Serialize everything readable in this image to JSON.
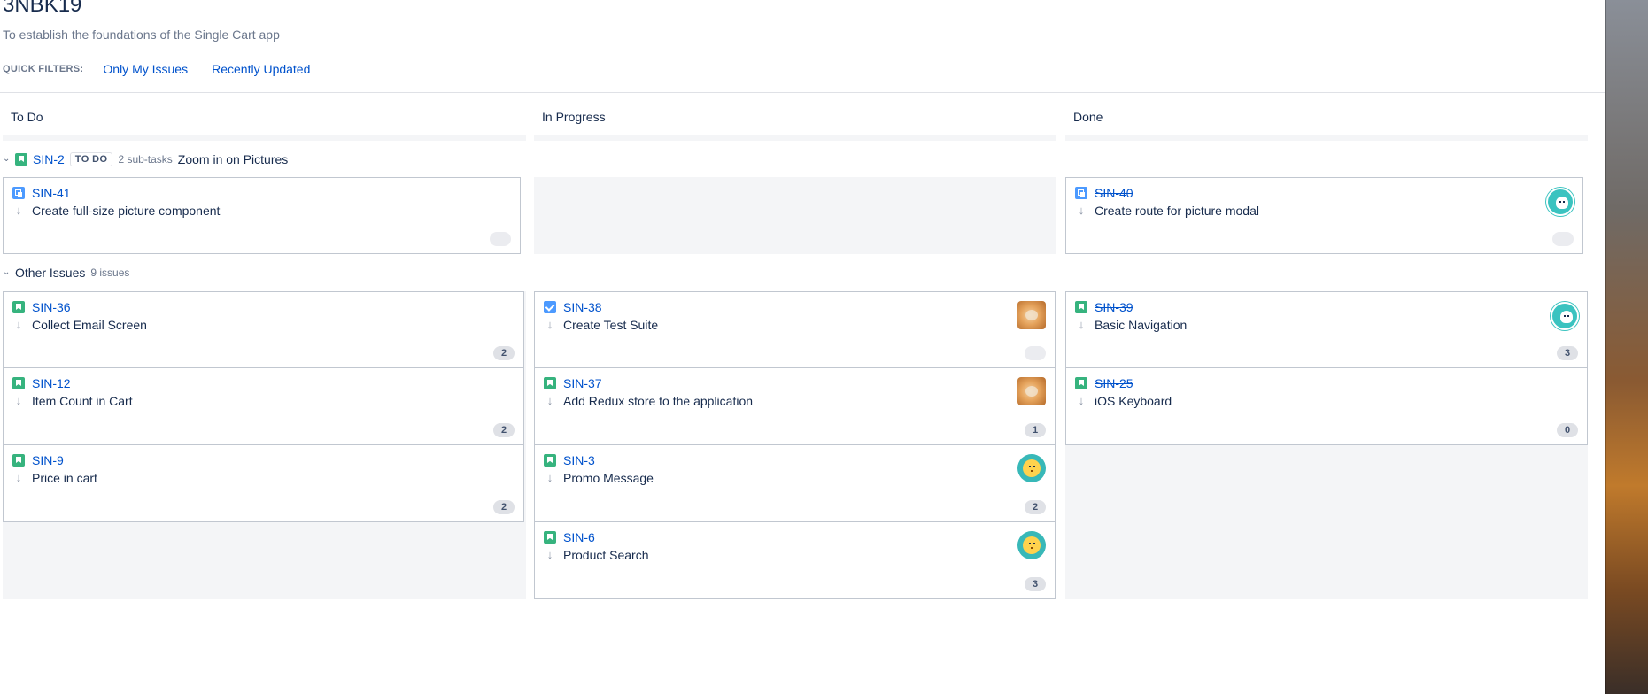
{
  "board": {
    "title": "3NBK19",
    "subtitle": "To establish the foundations of the Single Cart app"
  },
  "quick_filters": {
    "label": "QUICK FILTERS:",
    "items": [
      "Only My Issues",
      "Recently Updated"
    ]
  },
  "columns": [
    "To Do",
    "In Progress",
    "Done"
  ],
  "swimlanes": [
    {
      "key": "SIN-2",
      "status": "TO DO",
      "meta": "2 sub-tasks",
      "summary": "Zoom in on Pictures",
      "icon": "story-icon"
    },
    {
      "title": "Other Issues",
      "meta": "9 issues"
    }
  ],
  "cards": {
    "sin41": {
      "key": "SIN-41",
      "summary": "Create full-size picture component",
      "icon": "subtask-icon",
      "priority": "low",
      "estimate": ""
    },
    "sin40": {
      "key": "SIN-40",
      "summary": "Create route for picture modal",
      "icon": "subtask-icon",
      "priority": "low",
      "estimate": "",
      "avatar": "ghost"
    },
    "sin36": {
      "key": "SIN-36",
      "summary": "Collect Email Screen",
      "icon": "story-icon",
      "priority": "low",
      "estimate": "2"
    },
    "sin12": {
      "key": "SIN-12",
      "summary": "Item Count in Cart",
      "icon": "story-icon",
      "priority": "low",
      "estimate": "2"
    },
    "sin9": {
      "key": "SIN-9",
      "summary": "Price in cart",
      "icon": "story-icon",
      "priority": "low",
      "estimate": "2"
    },
    "sin38": {
      "key": "SIN-38",
      "summary": "Create Test Suite",
      "icon": "task-icon",
      "priority": "low",
      "estimate": "",
      "avatar": "dog"
    },
    "sin37": {
      "key": "SIN-37",
      "summary": "Add Redux store to the application",
      "icon": "story-icon",
      "priority": "low",
      "estimate": "1",
      "avatar": "dog"
    },
    "sin3": {
      "key": "SIN-3",
      "summary": "Promo Message",
      "icon": "story-icon",
      "priority": "low",
      "estimate": "2",
      "avatar": "yellow"
    },
    "sin6": {
      "key": "SIN-6",
      "summary": "Product Search",
      "icon": "story-icon",
      "priority": "low",
      "estimate": "3",
      "avatar": "yellow"
    },
    "sin39": {
      "key": "SIN-39",
      "summary": "Basic Navigation",
      "icon": "story-icon",
      "priority": "low",
      "estimate": "3",
      "avatar": "ghost"
    },
    "sin25": {
      "key": "SIN-25",
      "summary": "iOS Keyboard",
      "icon": "story-icon",
      "priority": "low",
      "estimate": "0"
    }
  },
  "icons": {
    "priority_low": "↓",
    "chevron": "⌄"
  },
  "colors": {
    "link": "#0052cc",
    "story": "#36b37e",
    "subtask": "#4c9aff",
    "column_bg": "#f4f5f7"
  }
}
